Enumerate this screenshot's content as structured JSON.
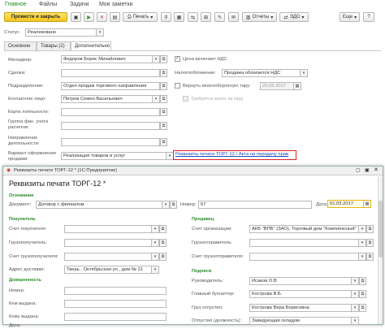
{
  "menu": [
    "Главное",
    "Файлы",
    "Задачи",
    "Мои заметки"
  ],
  "toolbar": {
    "post_close": "Провести и закрыть",
    "print": "Печать",
    "reports": "Отчеты",
    "edo": "ЭДО",
    "more": "Еще",
    "help": "?"
  },
  "status": {
    "label": "Статус:",
    "value": "Реализовано"
  },
  "tabs": [
    "Основное",
    "Товары (2)",
    "Дополнительно"
  ],
  "main": {
    "manager": {
      "label": "Менеджер:",
      "value": "Федоров Борис Михайлович"
    },
    "deal": {
      "label": "Сделка:",
      "value": ""
    },
    "division": {
      "label": "Подразделение:",
      "value": "Отдел продаж торгового направления"
    },
    "contact": {
      "label": "Контактное лицо:",
      "value": "Петров Семен Васильевич"
    },
    "loyalty": {
      "label": "Карта лояльности:",
      "value": ""
    },
    "fin_group": {
      "label": "Группа фин. учета расчетов:",
      "value": ""
    },
    "direction": {
      "label": "Направление деятельности:",
      "value": ""
    },
    "sale_variant": {
      "label": "Вариант оформления продажи:",
      "value": "Реализация товаров и услуг"
    },
    "vat_incl": {
      "label": "Цена включает НДС"
    },
    "tax": {
      "label": "Налогообложение:",
      "value": "Продажа облагается НДС"
    },
    "return_tara": {
      "label": "Вернуть многооборотную тару:",
      "date": "20.03.2017"
    },
    "deposit": {
      "label": "Требуется залог за тару"
    },
    "link": "Реквизиты печати ТОРГ-12 / Акта на передачу прав"
  },
  "dialog": {
    "window_title": "Реквизиты печати ТОРГ-12 * (1С:Предприятие)",
    "title": "Реквизиты печати ТОРГ-12 *",
    "basis_section": "Основание",
    "document": {
      "label": "Документ:",
      "value": "Договор с филиалом"
    },
    "number": {
      "label": "Номер:",
      "value": "67"
    },
    "date": {
      "label": "Дата:",
      "value": "01.03.2017"
    },
    "buyer_section": "Покупатель",
    "seller_section": "Продавец",
    "buyer_account": {
      "label": "Счет покупателя:"
    },
    "consignee": {
      "label": "Грузополучатель:"
    },
    "consignee_account": {
      "label": "Счет грузополучателя:"
    },
    "delivery_address": {
      "label": "Адрес доставки:",
      "value": "Тверь , Октябрьская ул., дом № 21"
    },
    "org_account": {
      "label": "Счет организации:",
      "value": "АКБ \"ВПБ\" (ЗАО), Торговый дом \"Комплексный\""
    },
    "shipper": {
      "label": "Грузоотправитель:"
    },
    "shipper_account": {
      "label": "Счет грузоотправителя:"
    },
    "signatures_section": "Подписи",
    "head": {
      "label": "Руководитель:",
      "value": "Исаков О.В"
    },
    "chief_accountant": {
      "label": "Главный бухгалтер:",
      "value": "Кострова В.Б."
    },
    "released_by": {
      "label": "Груз отпустил:",
      "value": "Кострова Вера Борисовна"
    },
    "released_pos": {
      "label": "Отпустил (должность):",
      "value": "Заведующая складом"
    },
    "power_section": "Доверенность",
    "pa_number": {
      "label": "Номер:"
    },
    "issued_by": {
      "label": "Кем выдана:"
    },
    "issued_to": {
      "label": "Кому выдана:"
    },
    "pa_date": {
      "label": "Дата:"
    }
  }
}
